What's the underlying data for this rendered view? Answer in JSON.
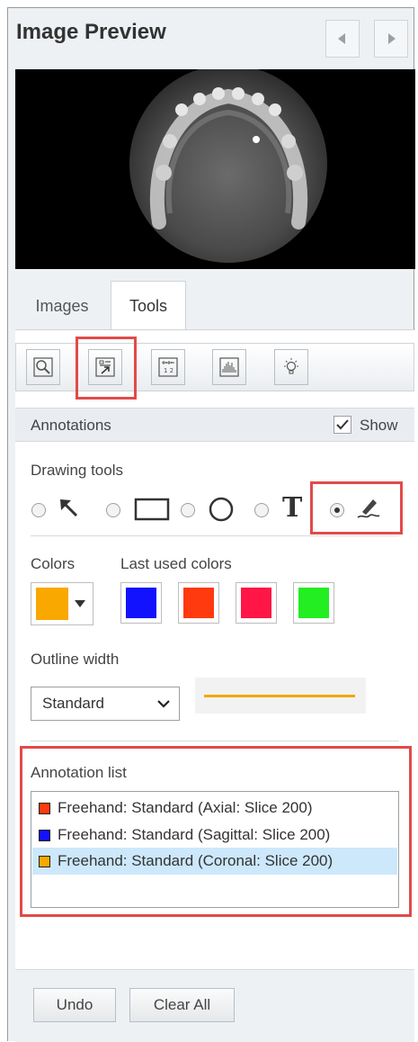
{
  "header": {
    "title": "Image Preview"
  },
  "tabs": [
    {
      "label": "Images"
    },
    {
      "label": "Tools"
    }
  ],
  "toolbar": {
    "tools": [
      "zoom-region-icon",
      "annotation-icon",
      "measure-icon",
      "histogram-icon",
      "brightness-icon"
    ]
  },
  "annotations": {
    "title": "Annotations",
    "show_label": "Show",
    "show_checked": true,
    "drawing_tools_label": "Drawing tools",
    "drawing_tools": [
      {
        "icon": "arrow-icon",
        "selected": false
      },
      {
        "icon": "rectangle-icon",
        "selected": false
      },
      {
        "icon": "ellipse-icon",
        "selected": false
      },
      {
        "icon": "text-icon",
        "glyph": "T",
        "selected": false
      },
      {
        "icon": "freehand-pen-icon",
        "selected": true
      }
    ],
    "colors_label": "Colors",
    "current_color": "#f9a800",
    "last_used_label": "Last used colors",
    "last_used_colors": [
      "#1212ff",
      "#ff3a0f",
      "#ff1546",
      "#22ee22"
    ],
    "outline_width_label": "Outline width",
    "outline_width_value": "Standard",
    "outline_preview_color": "#f0a800",
    "annotation_list_label": "Annotation list",
    "annotation_list": [
      {
        "text": "Freehand: Standard (Axial: Slice 200)",
        "color": "#ff3a0f",
        "selected": false
      },
      {
        "text": "Freehand: Standard (Sagittal: Slice 200)",
        "color": "#1212ff",
        "selected": false
      },
      {
        "text": "Freehand: Standard (Coronal: Slice 200)",
        "color": "#f9a800",
        "selected": true
      }
    ]
  },
  "buttons": {
    "undo": "Undo",
    "clear_all": "Clear All"
  }
}
